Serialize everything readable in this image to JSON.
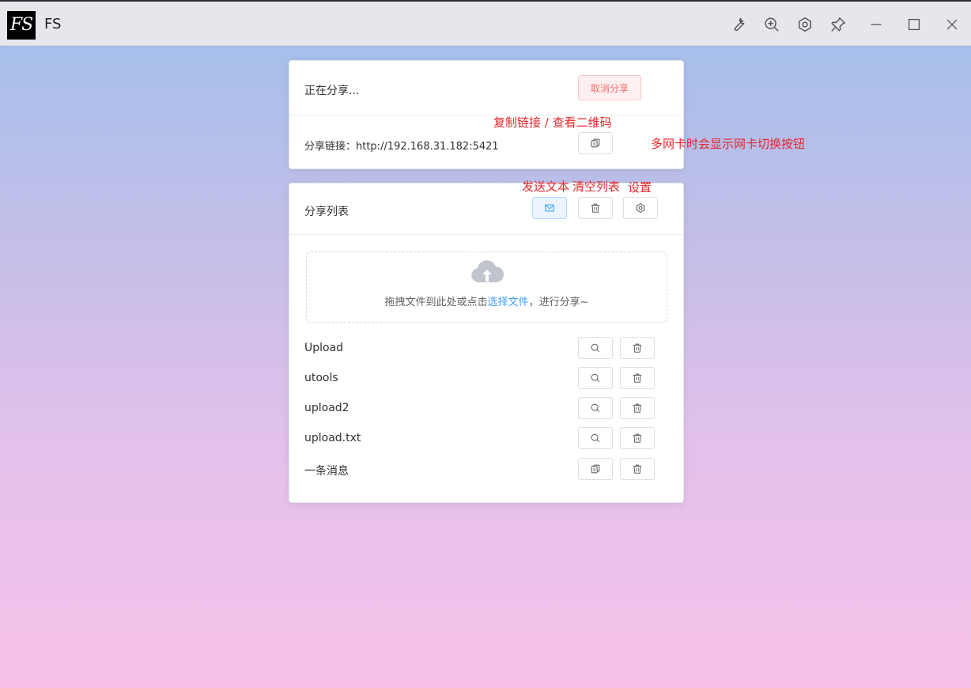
{
  "window": {
    "logo_text": "FS",
    "title": "FS",
    "controls": [
      "wrench-icon",
      "zoom-in-icon",
      "hexagon-settings-icon",
      "pin-icon",
      "minimize-icon",
      "maximize-icon",
      "close-icon"
    ]
  },
  "share_status": {
    "status_text": "正在分享...",
    "cancel_label": "取消分享",
    "link_label": "分享链接：http://192.168.31.182:5421"
  },
  "share_list": {
    "title": "分享列表",
    "upload": {
      "prefix": "拖拽文件到此处或点击",
      "link": "选择文件",
      "suffix": "，进行分享~"
    },
    "items": [
      {
        "name": "Upload",
        "action_icon": "search-icon"
      },
      {
        "name": "utools",
        "action_icon": "search-icon"
      },
      {
        "name": "upload2",
        "action_icon": "search-icon"
      },
      {
        "name": "upload.txt",
        "action_icon": "search-icon"
      },
      {
        "name": "一条消息",
        "action_icon": "copy-icon"
      }
    ]
  },
  "annotations": {
    "copy_link": "复制链接 / 查看二维码",
    "multi_nic": "多网卡时会显示网卡切换按钮",
    "send_text": "发送文本",
    "clear_list": "清空列表",
    "settings": "设置"
  },
  "colors": {
    "primary": "#409eff",
    "danger": "#f56c6c",
    "annotation": "#e8262b"
  }
}
